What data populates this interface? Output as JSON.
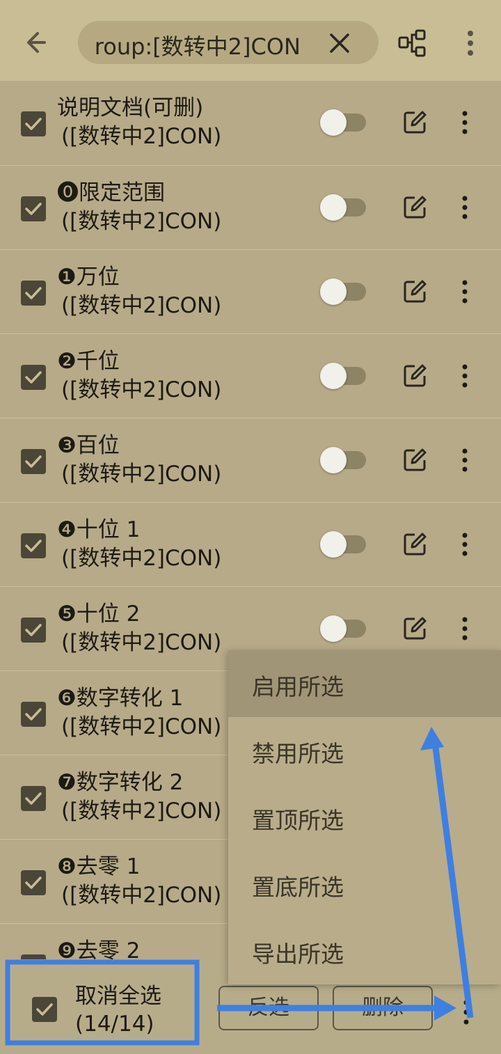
{
  "topbar": {
    "search_text": "roup:[数转中2]CON"
  },
  "items": [
    {
      "title": "说明文档(可删)",
      "subtitle": "([数转中2]CON)"
    },
    {
      "title": "⓿限定范围",
      "subtitle": "([数转中2]CON)"
    },
    {
      "title": "❶万位",
      "subtitle": "([数转中2]CON)"
    },
    {
      "title": "❷千位",
      "subtitle": "([数转中2]CON)"
    },
    {
      "title": "❸百位",
      "subtitle": "([数转中2]CON)"
    },
    {
      "title": "❹十位 1",
      "subtitle": "([数转中2]CON)"
    },
    {
      "title": "❺十位 2",
      "subtitle": "([数转中2]CON)"
    },
    {
      "title": "❻数字转化 1",
      "subtitle": "([数转中2]CON)"
    },
    {
      "title": "❼数字转化 2",
      "subtitle": "([数转中2]CON)"
    },
    {
      "title": "❽去零 1",
      "subtitle": "([数转中2]CON)"
    },
    {
      "title": "❾去零 2",
      "subtitle": ""
    }
  ],
  "menu": {
    "items": [
      "启用所选",
      "禁用所选",
      "置顶所选",
      "置底所选",
      "导出所选"
    ]
  },
  "bottombar": {
    "select_label": "取消全选",
    "select_count": "(14/14)",
    "invert_label": "反选",
    "delete_label": "删除"
  },
  "colors": {
    "header_bg": "#c8bd95",
    "list_bg": "#b7aa88",
    "checkbox": "#4b4637",
    "annotation_blue": "#3f7fe0"
  }
}
